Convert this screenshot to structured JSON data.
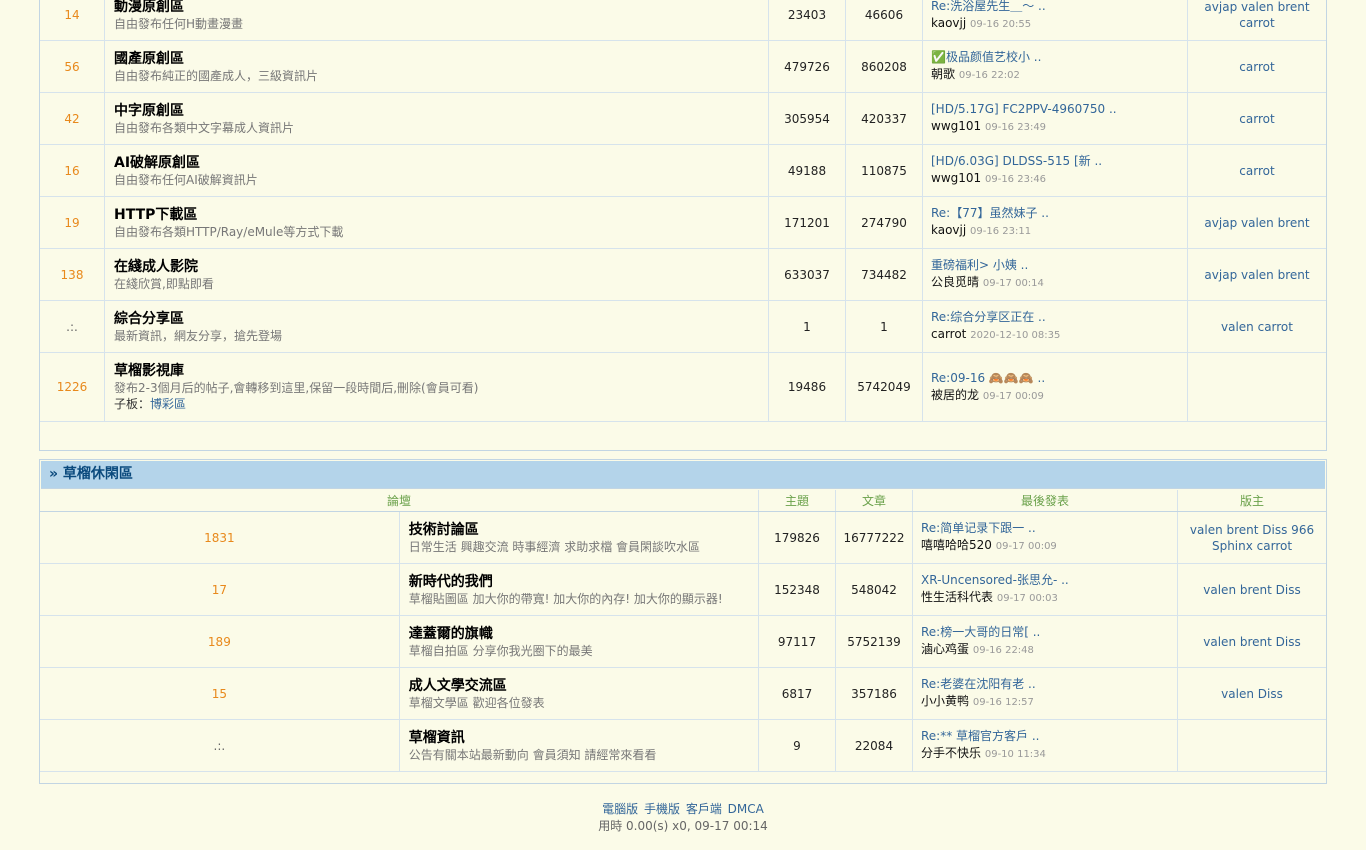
{
  "section1": {
    "forums": [
      {
        "count": "14",
        "name": "動漫原創區",
        "desc": "自由發布任何H動畫漫畫",
        "topics": "23403",
        "posts": "46606",
        "last_title": "Re:洗浴屋先生＿～ ..",
        "last_author": "kaovjj",
        "last_time": "09-16 20:55",
        "mods": "avjap valen brent carrot"
      },
      {
        "count": "56",
        "name": "國產原創區",
        "desc": "自由發布純正的國產成人，三級資訊片",
        "topics": "479726",
        "posts": "860208",
        "last_title": "✅极品颜值艺校小 ..",
        "last_author": "朝歌",
        "last_time": "09-16 22:02",
        "mods": "carrot"
      },
      {
        "count": "42",
        "name": "中字原創區",
        "desc": "自由發布各類中文字幕成人資訊片",
        "topics": "305954",
        "posts": "420337",
        "last_title": "[HD/5.17G] FC2PPV-4960750 ..",
        "last_author": "wwg101",
        "last_time": "09-16 23:49",
        "mods": "carrot"
      },
      {
        "count": "16",
        "name": "AI破解原創區",
        "desc": "自由發布任何AI破解資訊片",
        "topics": "49188",
        "posts": "110875",
        "last_title": "[HD/6.03G] DLDSS-515 [新 ..",
        "last_author": "wwg101",
        "last_time": "09-16 23:46",
        "mods": "carrot"
      },
      {
        "count": "19",
        "name": "HTTP下載區",
        "desc": "自由發布各類HTTP/Ray/eMule等方式下載",
        "topics": "171201",
        "posts": "274790",
        "last_title": "Re:【77】虽然妹子 ..",
        "last_author": "kaovjj",
        "last_time": "09-16 23:11",
        "mods": "avjap valen brent"
      },
      {
        "count": "138",
        "name": "在綫成人影院",
        "desc": "在綫欣賞,即點即看",
        "topics": "633037",
        "posts": "734482",
        "last_title": "重磅福利> 小姨 ..",
        "last_author": "公良觅晴",
        "last_time": "09-17 00:14",
        "mods": "avjap valen brent"
      },
      {
        "count": ".:.",
        "name": "綜合分享區",
        "desc": "最新資訊，網友分享，搶先登場",
        "topics": "1",
        "posts": "1",
        "last_title": "Re:综合分享区正在 ..",
        "last_author": "carrot",
        "last_time": "2020-12-10 08:35",
        "mods": "valen carrot"
      },
      {
        "count": "1226",
        "name": "草榴影視庫",
        "desc": "發布2-3個月后的帖子,會轉移到這里,保留一段時間后,刪除(會員可看)",
        "sub_label": "子板：",
        "sub_link": "博彩區",
        "topics": "19486",
        "posts": "5742049",
        "last_title": "Re:09-16 🙈🙈🙈 ..",
        "last_author": "被居的龙",
        "last_time": "09-17 00:09",
        "mods": ""
      }
    ]
  },
  "section2": {
    "title": "» 草榴休閑區",
    "headers": {
      "forum": "論壇",
      "topics": "主題",
      "posts": "文章",
      "last": "最後發表",
      "mods": "版主"
    },
    "forums": [
      {
        "count": "1831",
        "name": "技術討論區",
        "desc": "日常生活 興趣交流 時事經濟 求助求檔 會員閑談吹水區",
        "topics": "179826",
        "posts": "16777222",
        "last_title": "Re:简单记录下跟一 ..",
        "last_author": "嘻嘻哈哈520",
        "last_time": "09-17 00:09",
        "mods": "valen brent Diss 966 Sphinx carrot"
      },
      {
        "count": "17",
        "name": "新時代的我們",
        "desc": "草榴貼圖區 加大你的帶寬! 加大你的內存! 加大你的顯示器!",
        "topics": "152348",
        "posts": "548042",
        "last_title": "XR-Uncensored-张思允- ..",
        "last_author": "性生活科代表",
        "last_time": "09-17 00:03",
        "mods": "valen brent Diss"
      },
      {
        "count": "189",
        "name": "達蓋爾的旗幟",
        "desc": "草榴自拍區 分享你我光圈下的最美",
        "topics": "97117",
        "posts": "5752139",
        "last_title": "Re:榜一大哥的日常[ ..",
        "last_author": "滷心鸡蛋",
        "last_time": "09-16 22:48",
        "mods": "valen brent Diss"
      },
      {
        "count": "15",
        "name": "成人文學交流區",
        "desc": "草榴文學區 歡迎各位發表",
        "topics": "6817",
        "posts": "357186",
        "last_title": "Re:老婆在沈阳有老 ..",
        "last_author": "小小黄鸭",
        "last_time": "09-16 12:57",
        "mods": "valen Diss"
      },
      {
        "count": ".:.",
        "name": "草榴資訊",
        "desc": "公告有關本站最新動向 會員須知 請經常來看看",
        "topics": "9",
        "posts": "22084",
        "last_title": "Re:** 草榴官方客戶 ..",
        "last_author": "分手不快乐",
        "last_time": "09-10 11:34",
        "mods": ""
      }
    ]
  },
  "footer": {
    "links": [
      "電腦版",
      "手機版",
      "客戶端",
      "DMCA"
    ],
    "stat": "用時 0.00(s) x0, 09-17 00:14"
  }
}
